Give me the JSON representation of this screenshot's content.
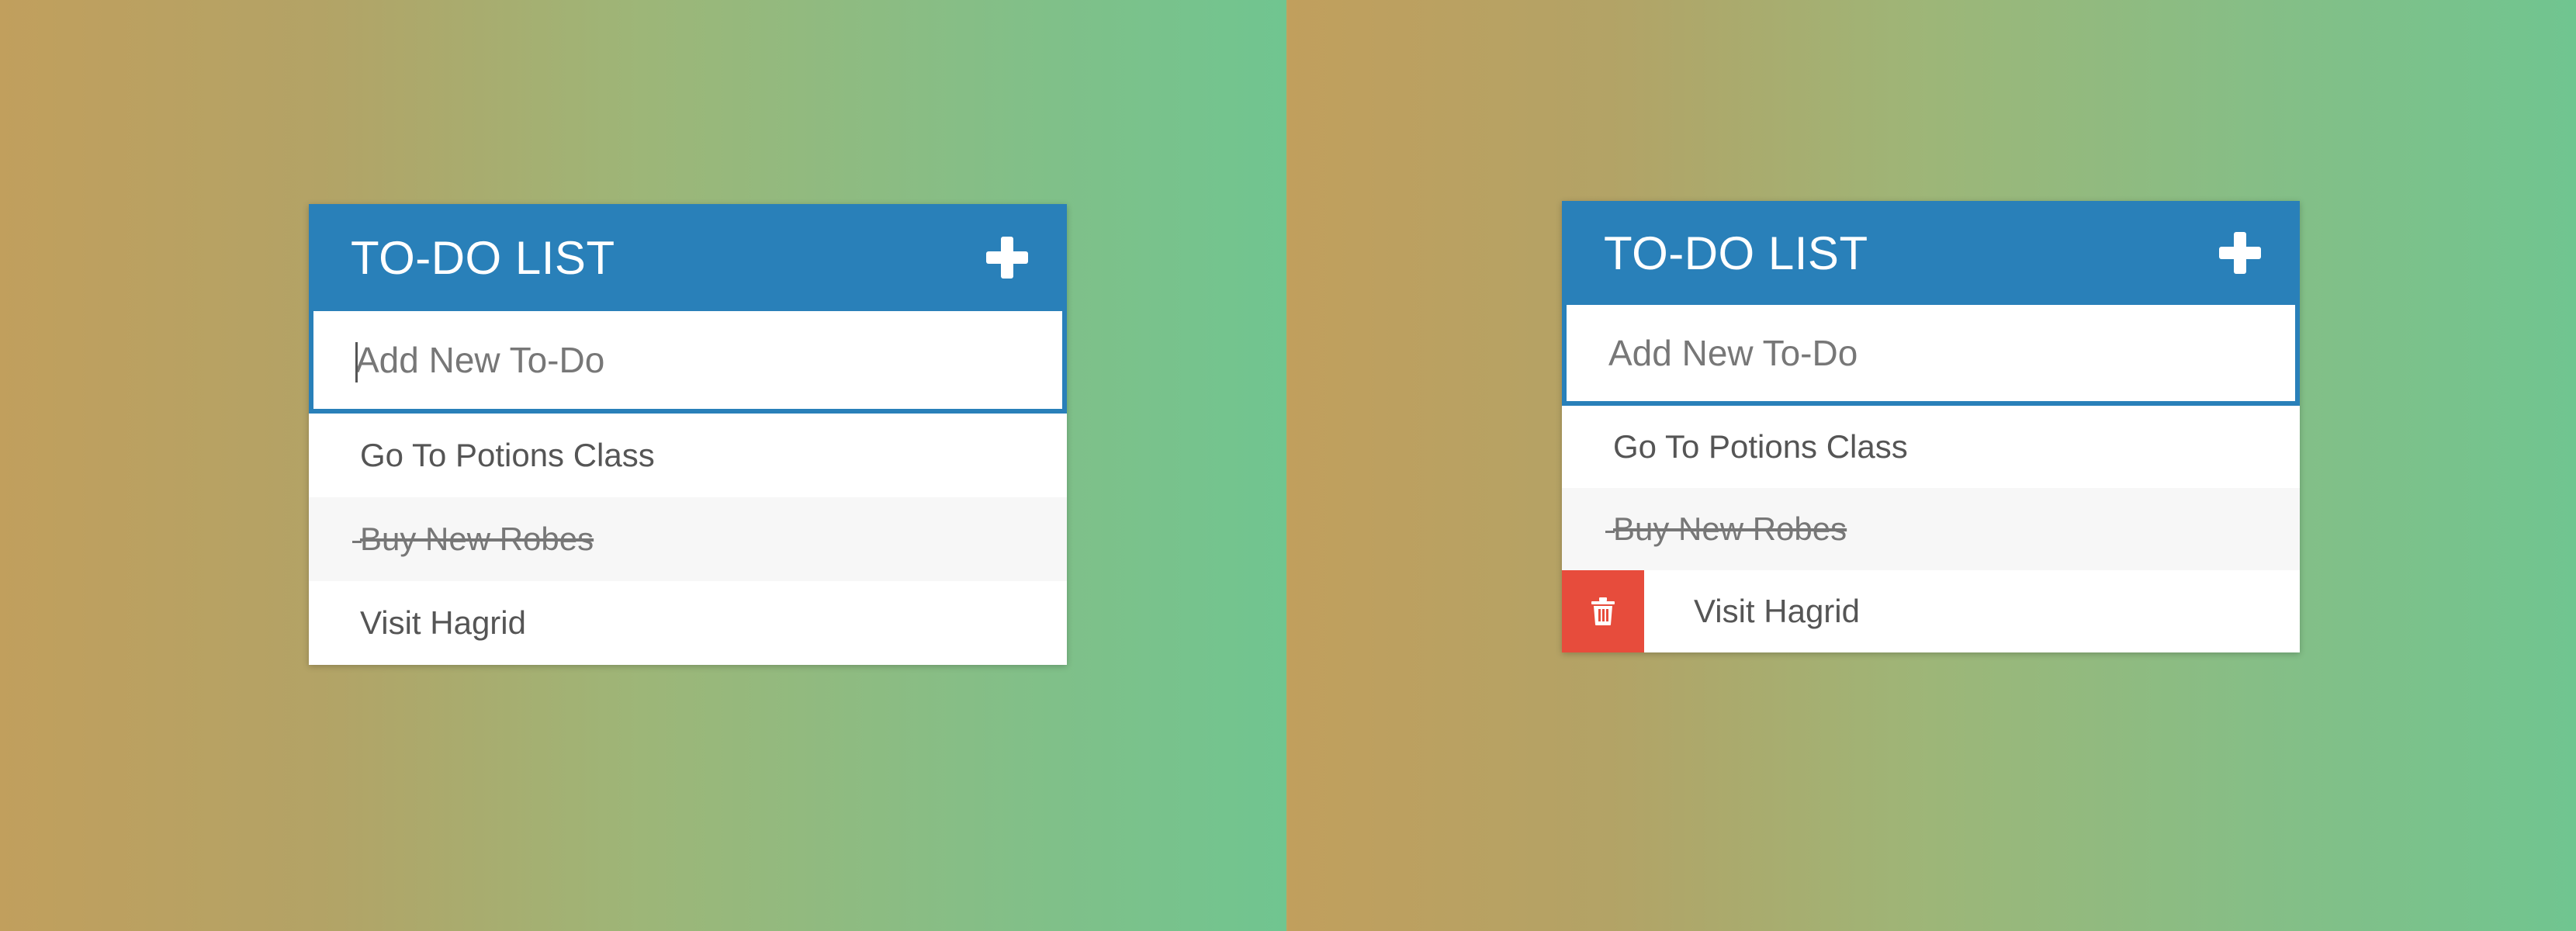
{
  "left_panel": {
    "title": "TO-DO LIST",
    "input_placeholder": "Add New To-Do",
    "todos": [
      {
        "label": "Go To Potions Class",
        "done": false
      },
      {
        "label": "Buy New Robes",
        "done": true
      },
      {
        "label": "Visit Hagrid",
        "done": false
      }
    ]
  },
  "right_panel": {
    "title": "TO-DO LIST",
    "input_placeholder": "Add New To-Do",
    "todos": [
      {
        "label": "Go To Potions Class",
        "done": false
      },
      {
        "label": "Buy New Robes",
        "done": true
      },
      {
        "label": "Visit Hagrid",
        "done": false
      }
    ]
  },
  "colors": {
    "header_blue": "#2980b9",
    "delete_red": "#e74c3c",
    "gradient_start": "#c19f5d",
    "gradient_end": "#70c590"
  },
  "icons": {
    "add": "plus-icon",
    "delete": "trash-icon"
  }
}
